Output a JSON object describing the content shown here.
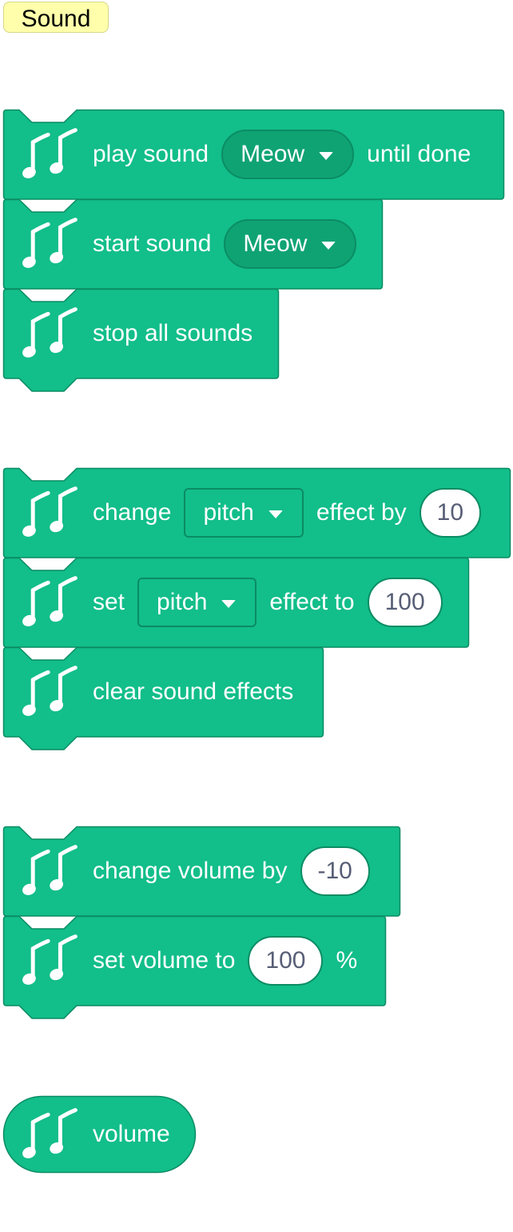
{
  "category": "Sound",
  "colors": {
    "block": "#12be8a",
    "border": "#0b8c63",
    "dropdown": "#0fa373",
    "input_text": "#575e75"
  },
  "icon": "music-notes-icon",
  "blocks": {
    "play_sound": {
      "text_before": "play sound",
      "dropdown": "Meow",
      "text_after": "until done"
    },
    "start_sound": {
      "text_before": "start sound",
      "dropdown": "Meow"
    },
    "stop_all": {
      "text": "stop all sounds"
    },
    "change_effect": {
      "text_before": "change",
      "dropdown": "pitch",
      "text_mid": "effect by",
      "value": "10"
    },
    "set_effect": {
      "text_before": "set",
      "dropdown": "pitch",
      "text_mid": "effect to",
      "value": "100"
    },
    "clear_effects": {
      "text": "clear sound effects"
    },
    "change_volume": {
      "text_before": "change volume by",
      "value": "-10"
    },
    "set_volume": {
      "text_before": "set volume to",
      "value": "100",
      "text_after": "%"
    },
    "volume_reporter": {
      "text": "volume"
    }
  }
}
